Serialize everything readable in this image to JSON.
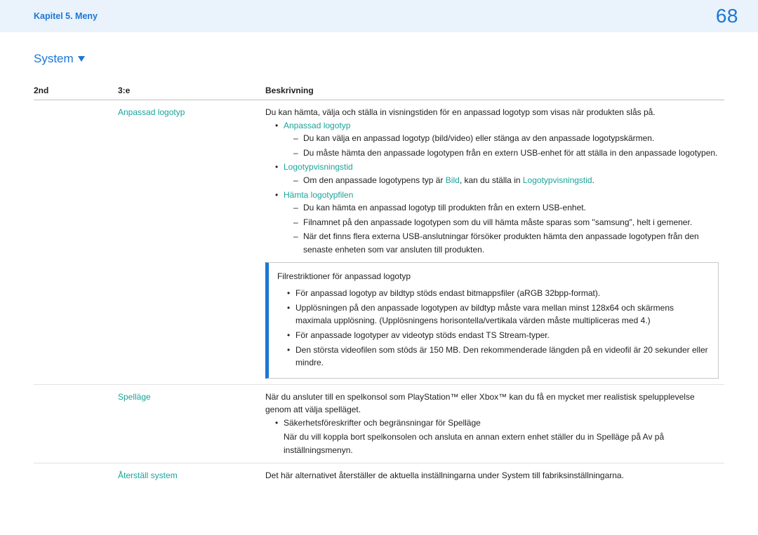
{
  "header": {
    "chapter": "Kapitel 5. Meny",
    "page_number": "68"
  },
  "section": {
    "title": "System"
  },
  "table": {
    "headers": {
      "c1": "2nd",
      "c2": "3:e",
      "c3": "Beskrivning"
    },
    "row1": {
      "c2": "Anpassad logotyp",
      "intro": "Du kan hämta, välja och ställa in visningstiden för en anpassad logotyp som visas när produkten slås på.",
      "b1_label": "Anpassad logotyp",
      "b1_d1": "Du kan välja en anpassad logotyp (bild/video) eller stänga av den anpassade logotypskärmen.",
      "b1_d2": "Du måste hämta den anpassade logotypen från en extern USB-enhet för att ställa in den anpassade logotypen.",
      "b2_label": "Logotypvisningstid",
      "b2_d1_pre": "Om den anpassade logotypens typ är ",
      "b2_d1_mid": "Bild",
      "b2_d1_mid2": ", kan du ställa in ",
      "b2_d1_link": "Logotypvisningstid",
      "b2_d1_post": ".",
      "b3_label": "Hämta logotypfilen",
      "b3_d1": "Du kan hämta en anpassad logotyp till produkten från en extern USB-enhet.",
      "b3_d2": "Filnamnet på den anpassade logotypen som du vill hämta måste sparas som \"samsung\", helt i gemener.",
      "b3_d3": "När det finns flera externa USB-anslutningar försöker produkten hämta den anpassade logotypen från den senaste enheten som var ansluten till produkten.",
      "box_title": "Filrestriktioner för anpassad logotyp",
      "box_b1": "För anpassad logotyp av bildtyp stöds endast bitmappsfiler (aRGB 32bpp-format).",
      "box_b2": "Upplösningen på den anpassade logotypen av bildtyp måste vara mellan minst 128x64 och skärmens maximala upplösning. (Upplösningens horisontella/vertikala värden måste multipliceras med 4.)",
      "box_b3": "För anpassade logotyper av videotyp stöds endast TS Stream-typer.",
      "box_b4": "Den största videofilen som stöds är 150 MB. Den rekommenderade längden på en videofil är 20 sekunder eller mindre."
    },
    "row2": {
      "c2": "Spelläge",
      "p1": "När du ansluter till en spelkonsol som PlayStation™ eller Xbox™ kan du få en mycket mer realistisk spelupplevelse genom att välja spelläget.",
      "b1": "Säkerhetsföreskrifter och begränsningar för Spelläge",
      "p2": "När du vill koppla bort spelkonsolen och ansluta en annan extern enhet ställer du in Spelläge på Av på inställningsmenyn."
    },
    "row3": {
      "c2": "Återställ system",
      "p1": "Det här alternativet återställer de aktuella inställningarna under System till fabriksinställningarna."
    }
  }
}
